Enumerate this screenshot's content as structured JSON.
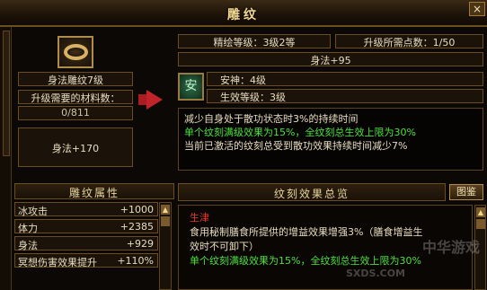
{
  "window": {
    "title": "雕纹",
    "close_label": "×"
  },
  "item": {
    "name": "身法雕纹7级",
    "materials_title": "升级需要的材料数：",
    "materials_count": "0/811",
    "stat": "身法+170"
  },
  "info": {
    "refine_level": "精绘等级：3级2等",
    "upgrade_points": "升级所需点数：1/50",
    "stat_bonus": "身法+95",
    "calm": "安神：4级",
    "effect_level": "生效等级：3级",
    "gem_glyph": "安"
  },
  "description": {
    "line1": "减少自身处于散功状态时3%的持续时间",
    "line2": "单个纹刻满级效果为15%，全纹刻总生效上限为30%",
    "line3": "当前已激活的纹刻总受到散功效果持续时间减少7%"
  },
  "attributes": {
    "header": "雕纹属性",
    "rows": [
      {
        "name": "冰攻击",
        "value": "+1000"
      },
      {
        "name": "体力",
        "value": "+2385"
      },
      {
        "name": "身法",
        "value": "+929"
      },
      {
        "name": "冥想伤害效果提升",
        "value": "+110%"
      }
    ]
  },
  "summary": {
    "header": "纹刻效果总览",
    "manual_button": "图鉴",
    "entry_title": "生津",
    "entry_line1": "食用秘制膳食所提供的增益效果增强3%（膳食增益生",
    "entry_line2": "效时不可卸下）",
    "entry_line3": "单个纹刻满级效果为15%，全纹刻总生效上限为30%"
  },
  "colors": {
    "accent_gold": "#f0d890",
    "highlight_green": "#4fe040",
    "title_red": "#e43a2a"
  },
  "watermark": {
    "text": "SXDS.COM",
    "brand": "中华游戏"
  }
}
